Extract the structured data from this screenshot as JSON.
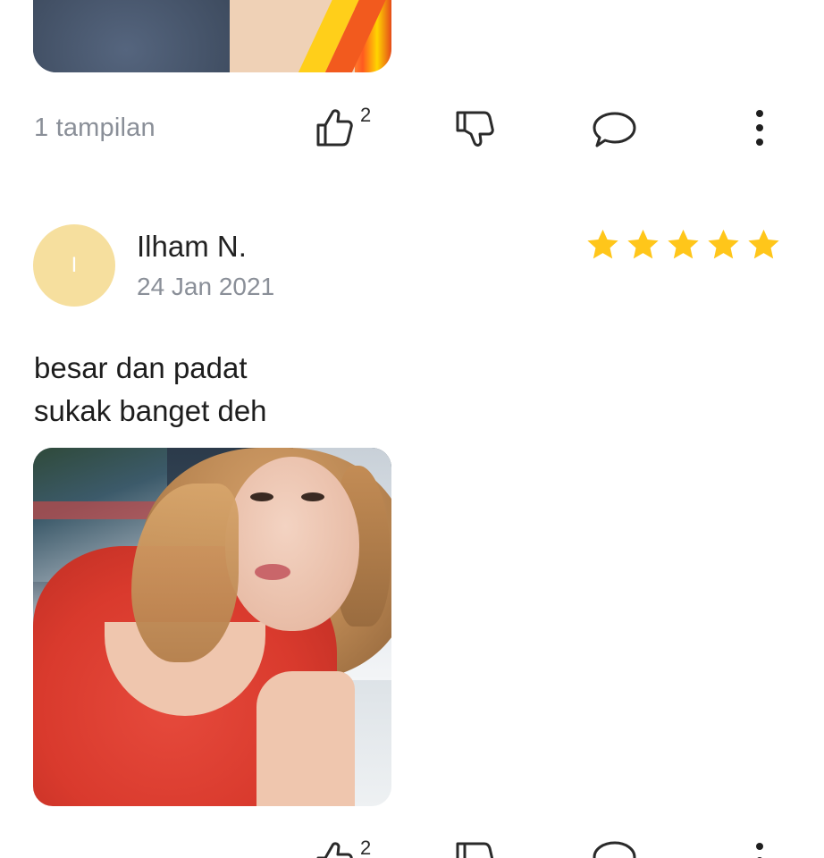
{
  "previous_review": {
    "views_text": "1 tampilan",
    "like_count": "2"
  },
  "review": {
    "avatar_initial": "I",
    "reviewer_name": "Ilham N.",
    "date": "24 Jan 2021",
    "rating": 5,
    "rating_max": 5,
    "text_lines": [
      "besar dan padat",
      "sukak banget deh"
    ],
    "like_count": "2"
  },
  "colors": {
    "star": "#FFC61A",
    "avatar_bg": "#F6DF9E",
    "muted_text": "#8A8F98",
    "icon_stroke": "#2A2A2A"
  },
  "icons": {
    "like": "thumbs-up-icon",
    "dislike": "thumbs-down-icon",
    "comment": "speech-bubble-icon",
    "more": "vertical-ellipsis-icon"
  }
}
